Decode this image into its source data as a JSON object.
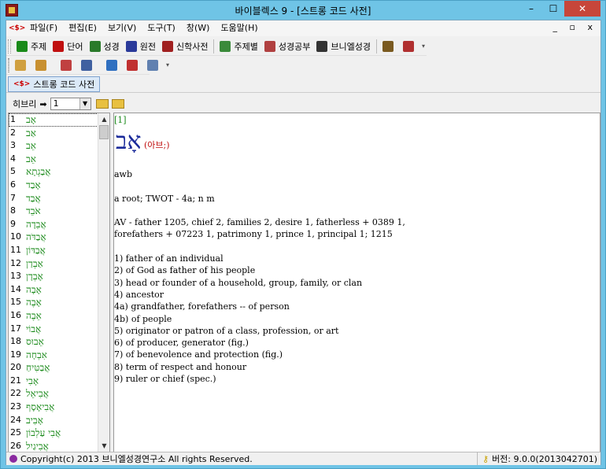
{
  "window": {
    "title": "바이블렉스 9 - [스트롱 코드 사전]",
    "minimize": "–",
    "maximize": "☐",
    "close": "✕"
  },
  "menu": {
    "logo": "<$>",
    "items": [
      "파일(F)",
      "편집(E)",
      "보기(V)",
      "도구(T)",
      "창(W)",
      "도움말(H)"
    ],
    "mdi": "_ ▫ x"
  },
  "toolbar1": {
    "buttons": [
      {
        "label": "주제",
        "icon": "bracket-green-icon",
        "color": "#1a8a1a"
      },
      {
        "label": "단어",
        "icon": "bracket-red-icon",
        "color": "#c01010"
      },
      {
        "label": "성경",
        "icon": "book-green-icon",
        "color": "#2a7a2a"
      },
      {
        "label": "원전",
        "icon": "book-blue-icon",
        "color": "#2a3a9a"
      },
      {
        "label": "신학사전",
        "icon": "book-red-icon",
        "color": "#a02020"
      },
      {
        "label": "주제별",
        "icon": "topic-icon",
        "color": "#3a8a3a"
      },
      {
        "label": "성경공부",
        "icon": "study-icon",
        "color": "#b04040"
      },
      {
        "label": "브니엘성경",
        "icon": "book-dark-icon",
        "color": "#333333"
      }
    ]
  },
  "toolbar2": {
    "icons": [
      "find-icon",
      "open-icon",
      "copy-icon",
      "print-icon",
      "notes-icon",
      "grid-icon",
      "document-icon"
    ]
  },
  "tab": {
    "logo": "<$>",
    "label": "스트롱 코드 사전"
  },
  "nav": {
    "label": "히브리",
    "select_value": "1"
  },
  "list": {
    "rows": [
      {
        "num": "1",
        "heb": "אָב"
      },
      {
        "num": "2",
        "heb": "אַב"
      },
      {
        "num": "3",
        "heb": "אֵב"
      },
      {
        "num": "4",
        "heb": "אֵב"
      },
      {
        "num": "5",
        "heb": "אֲבַגְתָא"
      },
      {
        "num": "6",
        "heb": "אָבַד"
      },
      {
        "num": "7",
        "heb": "אֲבַד"
      },
      {
        "num": "8",
        "heb": "אֹבֵד"
      },
      {
        "num": "9",
        "heb": "אֲבֵדָה"
      },
      {
        "num": "10",
        "heb": "אֲבַדֹּה"
      },
      {
        "num": "11",
        "heb": "אֲבַדּוֹן"
      },
      {
        "num": "12",
        "heb": "אַבְדַן"
      },
      {
        "num": "13",
        "heb": "אׇבְדָן"
      },
      {
        "num": "14",
        "heb": "אָבָה"
      },
      {
        "num": "15",
        "heb": "אָבֶה"
      },
      {
        "num": "16",
        "heb": "אֵבֶה"
      },
      {
        "num": "17",
        "heb": "אֲבוֹי"
      },
      {
        "num": "18",
        "heb": "אֵבוּס"
      },
      {
        "num": "19",
        "heb": "אִבְחָה"
      },
      {
        "num": "20",
        "heb": "אֲבַטִּיחַ"
      },
      {
        "num": "21",
        "heb": "אָבִי"
      },
      {
        "num": "22",
        "heb": "אֲבִיאֵל"
      },
      {
        "num": "23",
        "heb": "אֲבִיאָסָף"
      },
      {
        "num": "24",
        "heb": "אָבִיב"
      },
      {
        "num": "25",
        "heb": "אֲבִי עַלְבוֹן"
      },
      {
        "num": "26",
        "heb": "אֲבִיגַיִל"
      }
    ]
  },
  "entry": {
    "num": "[1]",
    "hebrew": "אָב",
    "pron": "(아브;)",
    "translit": "awb",
    "root": "a root; TWOT - 4a; n m",
    "av1": "AV - father 1205, chief 2, families 2, desire 1, fatherless + 0389 1,",
    "av2": "forefathers + 07223 1, patrimony 1, prince 1, principal 1; 1215",
    "defs": [
      "1) father of an individual",
      "2) of God as father of his people",
      "3) head or founder of a household, group, family, or clan",
      "4) ancestor",
      "4a) grandfather, forefathers -- of person",
      "4b) of people",
      "5) originator or patron of a class, profession, or art",
      "6) of producer, generator (fig.)",
      "7) of benevolence and protection (fig.)",
      "8) term of respect and honour",
      "9) ruler or chief (spec.)"
    ]
  },
  "status": {
    "copyright": "Copyright(c) 2013 브니엘성경연구소 All rights Reserved.",
    "version": "버전: 9.0.0(2013042701)"
  }
}
